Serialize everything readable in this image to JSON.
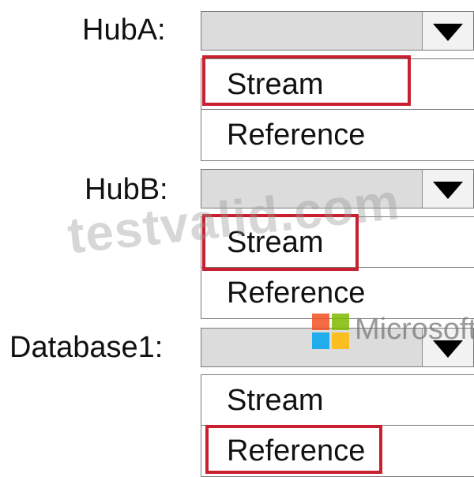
{
  "hub_a": {
    "label": "HubA:",
    "options": [
      "Stream",
      "Reference"
    ],
    "highlighted": "Stream"
  },
  "hub_b": {
    "label": "HubB:",
    "options": [
      "Stream",
      "Reference"
    ],
    "highlighted": "Stream"
  },
  "database1": {
    "label": "Database1:",
    "options": [
      "Stream",
      "Reference"
    ],
    "highlighted": "Reference"
  },
  "watermark": {
    "site_text": "testvalid.com",
    "brand_text": "Microsoft",
    "brand_colors": [
      "#f25022",
      "#7fba00",
      "#00a4ef",
      "#ffb900"
    ]
  },
  "highlight_color": "#c8202f"
}
